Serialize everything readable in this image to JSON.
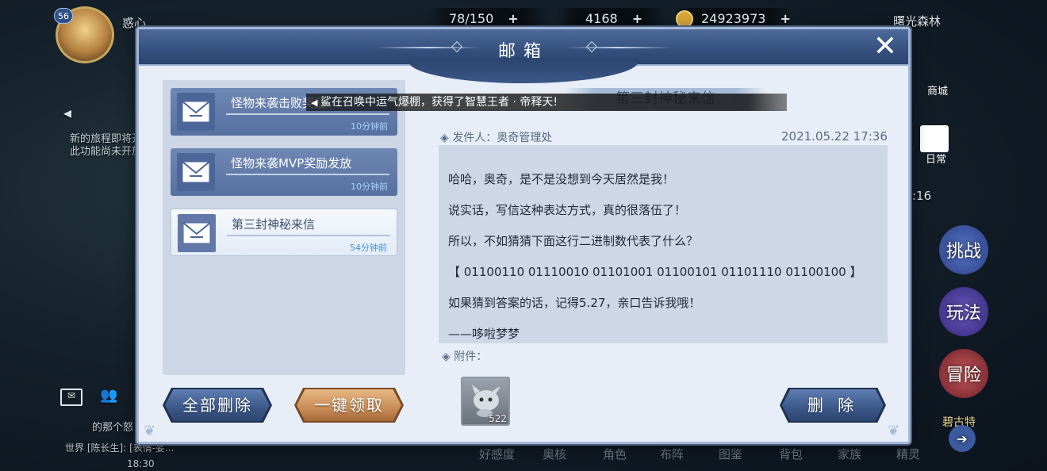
{
  "hud": {
    "player_level": "56",
    "player_name": "惑心",
    "stamina": "78/150",
    "diamonds": "4168",
    "gold": "24923973",
    "location": "曙光森林",
    "shop_label": "商城",
    "daily_label": "日常",
    "challenge_label": "挑战",
    "play_label": "玩法",
    "adventure_label": "冒险",
    "bg_notice_line1": "新的旅程即将开",
    "bg_notice_line2": "此功能尚未开放",
    "clock": "18:30",
    "world_chat": "世界 [陈长生]: [表情-娑...",
    "chat_preview": "的那个怒",
    "side_time": ":16",
    "side_tag": "碧古特",
    "plus": "+",
    "bottom_tabs": [
      "好感度",
      "奥核",
      "角色",
      "布阵",
      "图鉴",
      "背包",
      "家族",
      "精灵"
    ]
  },
  "mail": {
    "title": "邮箱",
    "close_symbol": "✕",
    "items": [
      {
        "subject": "怪物来袭击败奖励",
        "time": "10分钟前",
        "selected": false
      },
      {
        "subject": "怪物来袭MVP奖励发放",
        "time": "10分钟前",
        "selected": false
      },
      {
        "subject": "第三封神秘来信",
        "time": "54分钟前",
        "selected": true
      }
    ],
    "notice_text": "鲨在召唤中运气爆棚，获得了智慧王者 · 帝释天!",
    "detail_title": "第三封神秘来信",
    "sender_label": "◈ 发件人：奥奇管理处",
    "date": "2021.05.22  17:36",
    "body_lines": [
      "哈哈，奥奇，是不是没想到今天居然是我！",
      "说实话，写信这种表达方式，真的很落伍了！",
      "所以，不如猜猜下面这行二进制数代表了什么？",
      "【 01100110 01110010 01101001 01100101 01101110 01100100 】",
      "如果猜到答案的话，记得5.27，亲口告诉我哦！",
      "——哆啦梦梦"
    ],
    "attachment_label": "◈ 附件：",
    "attachment_count": "522",
    "delete_all_label": "全部删除",
    "claim_all_label": "一键领取",
    "delete_label": "删 除"
  },
  "colors": {
    "header": "#35507e",
    "panel": "#ccd6e4",
    "accent_gold": "#c88c56",
    "time_blue": "#4a8fd8"
  }
}
